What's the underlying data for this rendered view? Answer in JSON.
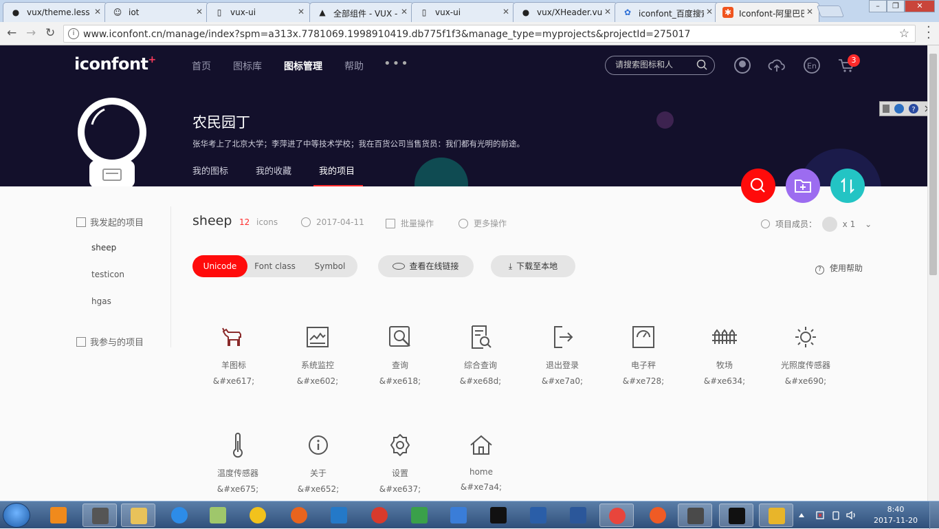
{
  "browser": {
    "tabs": [
      {
        "label": "vux/theme.less a",
        "icon": "github-icon"
      },
      {
        "label": "iot",
        "icon": "avatar-icon"
      },
      {
        "label": "vux-ui",
        "icon": "page-icon"
      },
      {
        "label": "全部组件 - VUX -",
        "icon": "vux-icon"
      },
      {
        "label": "vux-ui",
        "icon": "page-icon"
      },
      {
        "label": "vux/XHeader.vue",
        "icon": "github-icon"
      },
      {
        "label": "iconfont_百度搜索",
        "icon": "baidu-icon"
      },
      {
        "label": "Iconfont-阿里巴巴",
        "icon": "iconfont-icon"
      }
    ],
    "url": "www.iconfont.cn/manage/index?spm=a313x.7781069.1998910419.db775f1f3&manage_type=myprojects&projectId=275017"
  },
  "header": {
    "logo": "iconfont",
    "nav": [
      "首页",
      "图标库",
      "图标管理",
      "帮助"
    ],
    "nav_active": "图标管理",
    "more": "•••",
    "search_placeholder": "请搜索图标和人",
    "cart_count": "3",
    "lang": "En"
  },
  "profile": {
    "name": "农民园丁",
    "motto": "张华考上了北京大学；李萍进了中等技术学校；我在百货公司当售货员：我们都有光明的前途。",
    "tabs": [
      "我的图标",
      "我的收藏",
      "我的项目"
    ],
    "active_tab": "我的项目"
  },
  "sidebar": {
    "my_projects_title": "我发起的项目",
    "projects": [
      "sheep",
      "testicon",
      "hgas"
    ],
    "joined_title": "我参与的项目"
  },
  "project": {
    "name": "sheep",
    "count": "12",
    "count_unit": "icons",
    "date": "2017-04-11",
    "batch": "批量操作",
    "more_ops": "更多操作",
    "members_label": "项目成员：",
    "members_count": "x 1",
    "modes": [
      "Unicode",
      "Font class",
      "Symbol"
    ],
    "active_mode": "Unicode",
    "view_link": "查看在线链接",
    "download": "下载至本地",
    "help": "使用帮助"
  },
  "icons": [
    {
      "name": "羊图标",
      "code": "&#xe617;",
      "icon": "goat-icon"
    },
    {
      "name": "系统监控",
      "code": "&#xe602;",
      "icon": "monitor-icon"
    },
    {
      "name": "查询",
      "code": "&#xe618;",
      "icon": "search-icon"
    },
    {
      "name": "综合查询",
      "code": "&#xe68d;",
      "icon": "document-search-icon"
    },
    {
      "name": "退出登录",
      "code": "&#xe7a0;",
      "icon": "logout-icon"
    },
    {
      "name": "电子秤",
      "code": "&#xe728;",
      "icon": "scale-icon"
    },
    {
      "name": "牧场",
      "code": "&#xe634;",
      "icon": "ranch-icon"
    },
    {
      "name": "光照度传感器",
      "code": "&#xe690;",
      "icon": "light-sensor-icon"
    },
    {
      "name": "温度传感器",
      "code": "&#xe675;",
      "icon": "thermometer-icon"
    },
    {
      "name": "关于",
      "code": "&#xe652;",
      "icon": "info-icon"
    },
    {
      "name": "设置",
      "code": "&#xe637;",
      "icon": "gear-icon"
    },
    {
      "name": "home",
      "code": "&#xe7a4;",
      "icon": "home-icon"
    }
  ],
  "taskbar": {
    "time": "8:40",
    "date": "2017-11-20"
  },
  "colors": {
    "header_bg": "#13102b",
    "accent_red": "#ff0b0b",
    "fab_search": "#ff0b0b",
    "fab_add": "#9c6cf0",
    "fab_sort": "#23c4c4"
  }
}
